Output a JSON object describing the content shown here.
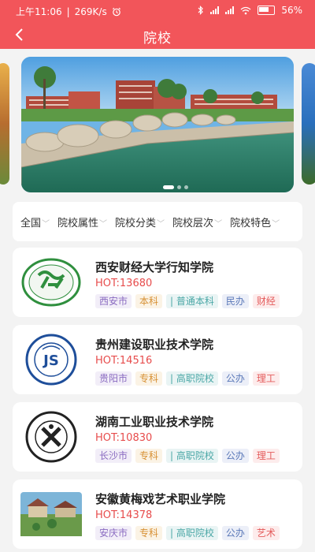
{
  "status_bar": {
    "time": "上午11:06",
    "speed": "269K/s",
    "battery": "56%"
  },
  "app_bar": {
    "title": "院校",
    "back_icon": "back-arrow-icon"
  },
  "carousel": {
    "slide_count": 3,
    "active_slide": 1
  },
  "filters": [
    {
      "label": "全国"
    },
    {
      "label": "院校属性"
    },
    {
      "label": "院校分类"
    },
    {
      "label": "院校层次"
    },
    {
      "label": "院校特色"
    }
  ],
  "schools": [
    {
      "name": "西安财经大学行知学院",
      "hot": "HOT:13680",
      "city": "西安市",
      "level": "本科",
      "type": "| 普通本科",
      "ownership": "民办",
      "category": "财经"
    },
    {
      "name": "贵州建设职业技术学院",
      "hot": "HOT:14516",
      "city": "贵阳市",
      "level": "专科",
      "type": "| 高职院校",
      "ownership": "公办",
      "category": "理工"
    },
    {
      "name": "湖南工业职业技术学院",
      "hot": "HOT:10830",
      "city": "长沙市",
      "level": "专科",
      "type": "| 高职院校",
      "ownership": "公办",
      "category": "理工"
    },
    {
      "name": "安徽黄梅戏艺术职业学院",
      "hot": "HOT:14378",
      "city": "安庆市",
      "level": "专科",
      "type": "| 高职院校",
      "ownership": "公办",
      "category": "艺术"
    }
  ],
  "colors": {
    "accent": "#f2555a",
    "hot": "#e74c4c"
  }
}
